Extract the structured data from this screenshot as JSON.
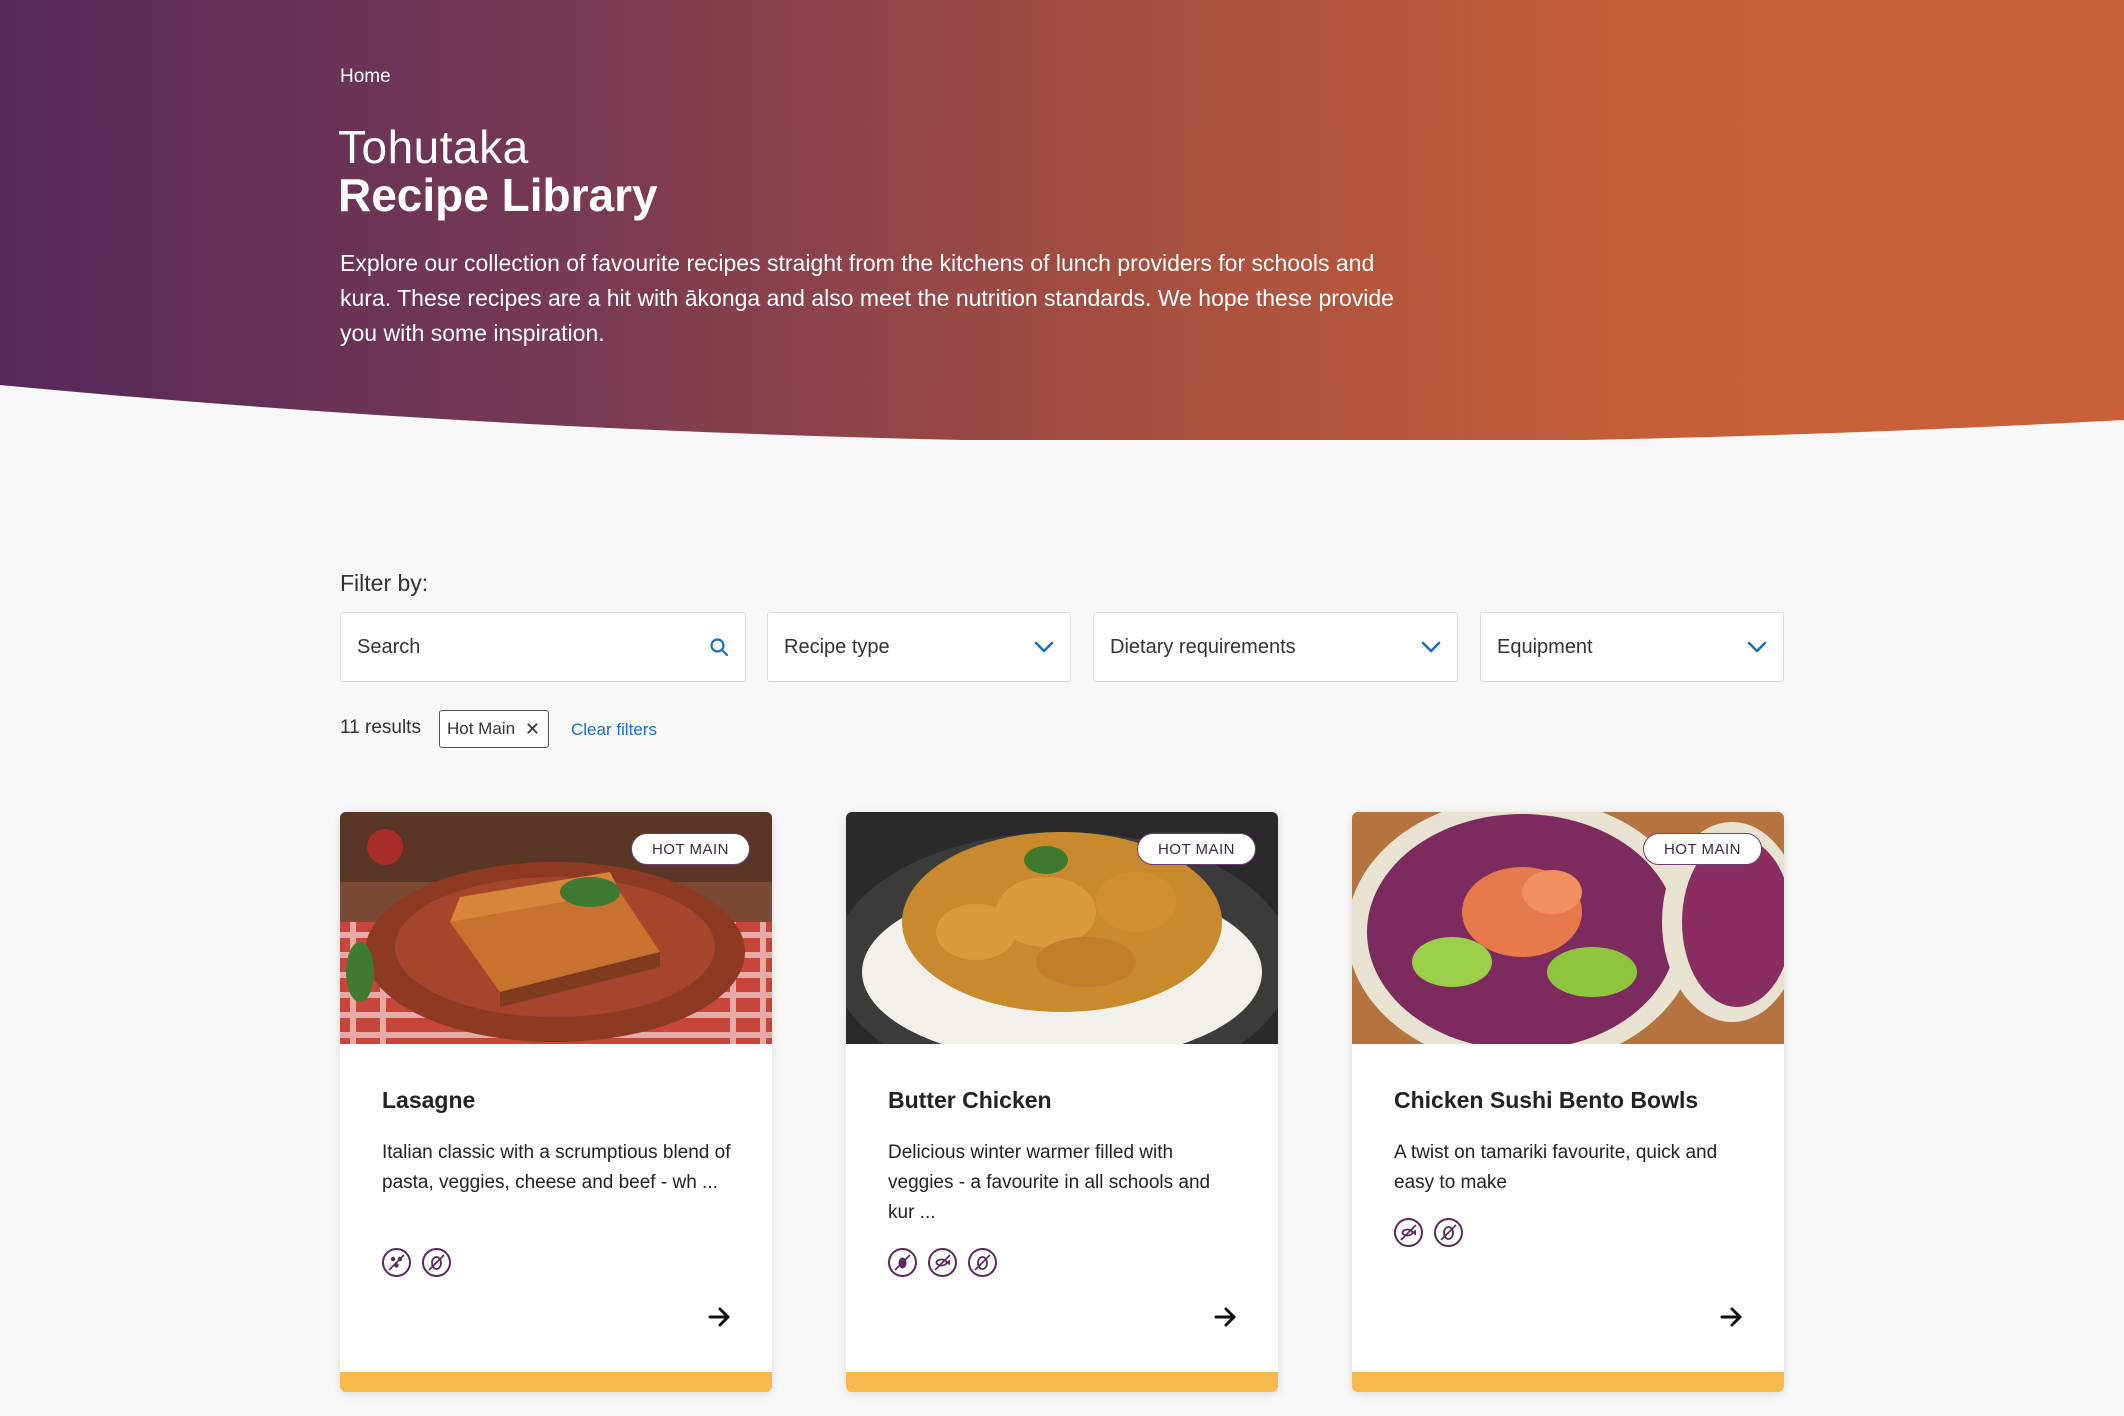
{
  "hero": {
    "breadcrumb": "Home",
    "title_line1": "Tohutaka",
    "title_line2": "Recipe Library",
    "intro": "Explore our collection of favourite recipes straight from the kitchens of lunch providers for schools and kura. These recipes are a hit with ākonga and also meet the nutrition standards. We hope these provide you with some inspiration.",
    "gradient_start": "#54295a",
    "gradient_end": "#c9603a"
  },
  "filters": {
    "label": "Filter by:",
    "search_placeholder": "Search",
    "recipe_type": "Recipe type",
    "dietary": "Dietary requirements",
    "equipment": "Equipment",
    "accent_color": "#1a6fc4"
  },
  "results": {
    "count_text": "11 results",
    "active_filter": "Hot Main",
    "clear_label": "Clear filters"
  },
  "cards": [
    {
      "badge": "HOT MAIN",
      "title": "Lasagne",
      "description": "Italian classic with a scrumptious blend of pasta, veggies, cheese and beef - wh ...",
      "icons": [
        "multi-grain-icon",
        "egg-free-icon"
      ]
    },
    {
      "badge": "HOT MAIN",
      "title": "Butter Chicken",
      "description": "Delicious winter warmer filled with veggies - a favourite in all schools and kur ...",
      "icons": [
        "nut-icon",
        "fish-free-icon",
        "egg-free-icon"
      ]
    },
    {
      "badge": "HOT MAIN",
      "title": "Chicken Sushi Bento Bowls",
      "description": "A twist on tamariki favourite, quick and easy to make",
      "icons": [
        "fish-free-icon",
        "egg-free-icon"
      ]
    }
  ],
  "card_bar_color": "#f7b84e"
}
